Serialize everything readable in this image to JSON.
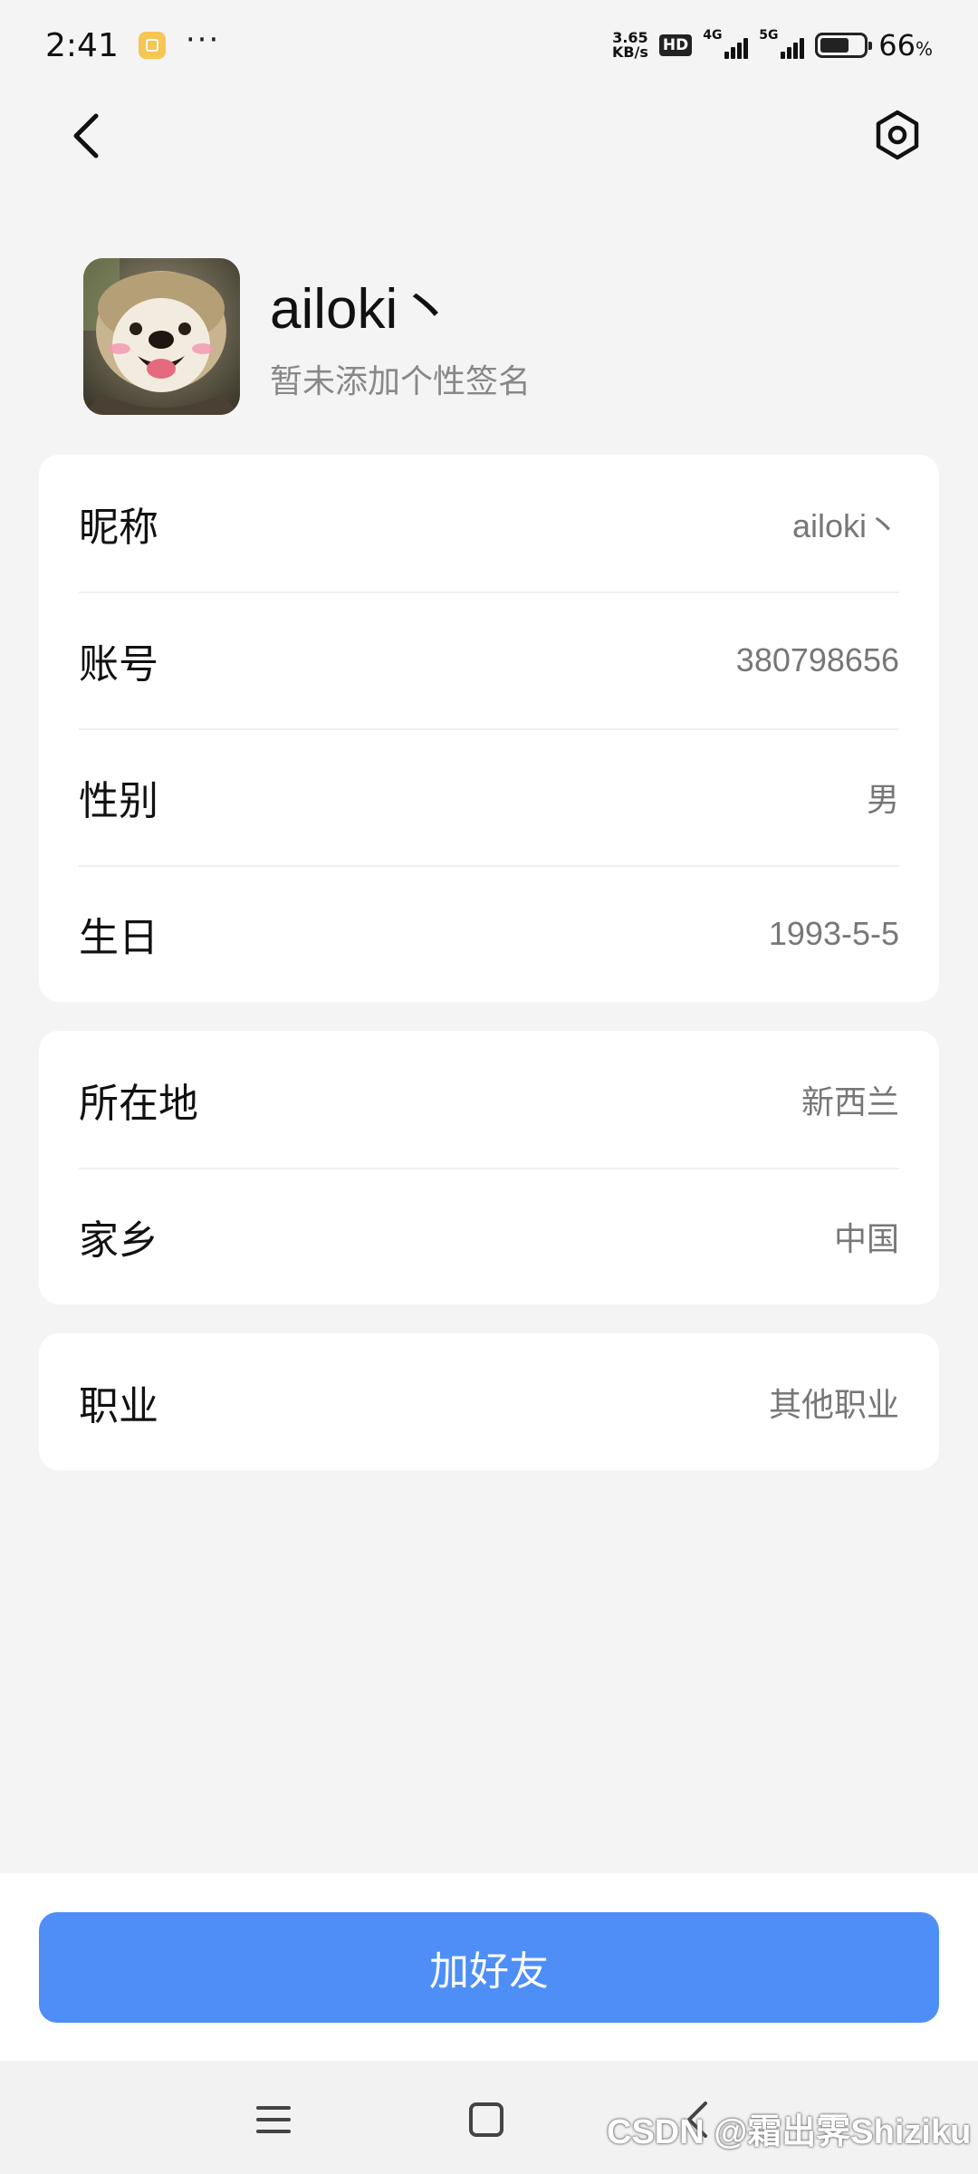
{
  "status_bar": {
    "time": "2:41",
    "dots": "···",
    "net_speed_value": "3.65",
    "net_speed_unit": "KB/s",
    "hd_label": "HD",
    "sim1_label": "4G",
    "sim2_label": "5G",
    "battery_level": 66,
    "battery_percent": "66",
    "percent_sign": "%"
  },
  "profile": {
    "name": "ailoki丶",
    "signature": "暂未添加个性签名"
  },
  "basic_info": [
    {
      "label": "昵称",
      "value": "ailoki丶"
    },
    {
      "label": "账号",
      "value": "380798656"
    },
    {
      "label": "性别",
      "value": "男"
    },
    {
      "label": "生日",
      "value": "1993-5-5"
    }
  ],
  "location_info": [
    {
      "label": "所在地",
      "value": "新西兰"
    },
    {
      "label": "家乡",
      "value": "中国"
    }
  ],
  "job_info": [
    {
      "label": "职业",
      "value": "其他职业"
    }
  ],
  "action": {
    "add_friend_label": "加好友"
  },
  "watermark": "CSDN @霜出霁Shiziku",
  "colors": {
    "background": "#f4f4f4",
    "card": "#ffffff",
    "primary_button": "#4e8ef7",
    "label_text": "#111111",
    "value_text": "#777777"
  },
  "icons": [
    "back-arrow-icon",
    "settings-hexagon-icon",
    "menu-icon",
    "home-square-icon",
    "nav-back-icon"
  ]
}
